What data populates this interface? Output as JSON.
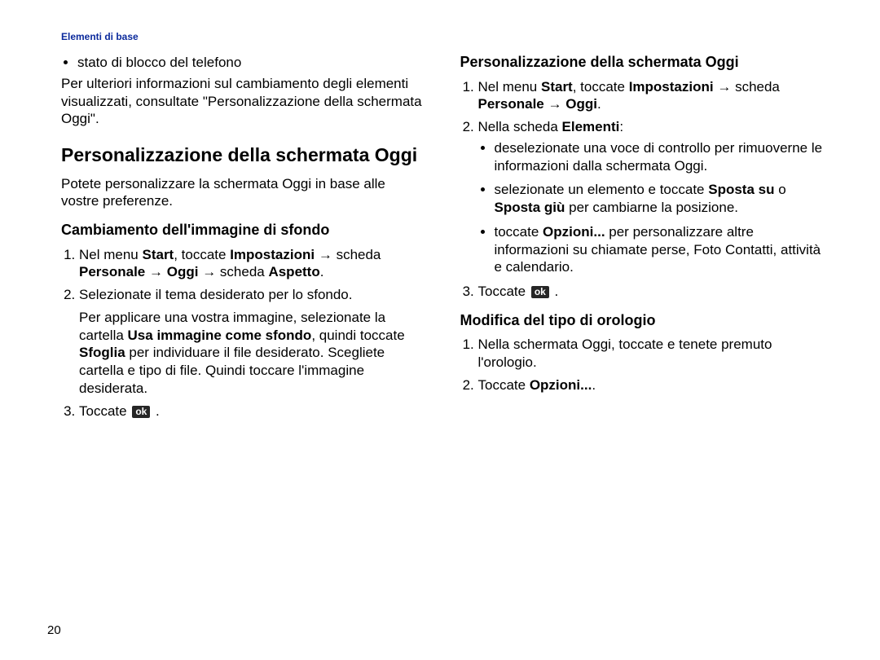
{
  "header": "Elementi di base",
  "page_number": "20",
  "arrow": "→",
  "ok_label": "ok",
  "left": {
    "bullet1": "stato di blocco del telefono",
    "intro_para": "Per ulteriori informazioni sul cambiamento degli elementi visualizzati, consultate \"Personalizzazione della schermata Oggi\".",
    "h2": "Personalizzazione della schermata Oggi",
    "h2_para": "Potete personalizzare la schermata Oggi in base alle vostre preferenze.",
    "sub1_title": "Cambiamento dell'immagine di sfondo",
    "sub1_step1_a": "Nel menu ",
    "sub1_step1_b_bold": "Start",
    "sub1_step1_c": ", toccate ",
    "sub1_step1_d_bold": "Impostazioni",
    "sub1_step1_e": " ",
    "sub1_step1_f": " scheda ",
    "sub1_step1_g_bold": "Personale",
    "sub1_step1_h": " ",
    "sub1_step1_i_bold": "Oggi",
    "sub1_step1_j": " ",
    "sub1_step1_k": " scheda ",
    "sub1_step1_l_bold": "Aspetto",
    "sub1_step1_m": ".",
    "sub1_step2": "Selezionate il tema desiderato per lo sfondo.",
    "sub1_step2_para_a": "Per applicare una vostra immagine, selezionate la cartella ",
    "sub1_step2_para_b_bold": "Usa immagine come sfondo",
    "sub1_step2_para_c": ", quindi toccate ",
    "sub1_step2_para_d_bold": "Sfoglia",
    "sub1_step2_para_e": " per individuare il file desiderato. Scegliete cartella e tipo di file. Quindi toccare l'immagine desiderata.",
    "sub1_step3_a": "Toccate ",
    "sub1_step3_c": " ."
  },
  "right": {
    "sub2_title": "Personalizzazione della schermata Oggi",
    "sub2_step1_a": "Nel menu ",
    "sub2_step1_b_bold": "Start",
    "sub2_step1_c": ", toccate ",
    "sub2_step1_d_bold": "Impostazioni",
    "sub2_step1_e": " ",
    "sub2_step1_f": " scheda ",
    "sub2_step1_g_bold": "Personale",
    "sub2_step1_h": " ",
    "sub2_step1_i_bold": "Oggi",
    "sub2_step1_j": ".",
    "sub2_step2_a": "Nella scheda ",
    "sub2_step2_b_bold": "Elementi",
    "sub2_step2_c": ":",
    "sub2_b1": "deselezionate una voce di controllo per rimuoverne le informazioni dalla schermata Oggi.",
    "sub2_b2_a": "selezionate un elemento e toccate ",
    "sub2_b2_b_bold": "Sposta su",
    "sub2_b2_c": " o ",
    "sub2_b2_d_bold": "Sposta giù",
    "sub2_b2_e": " per cambiarne la posizione.",
    "sub2_b3_a": "toccate ",
    "sub2_b3_b_bold": "Opzioni...",
    "sub2_b3_c": " per personalizzare altre informazioni su chiamate perse, Foto Contatti, attività e calendario.",
    "sub2_step3_a": "Toccate ",
    "sub2_step3_c": " .",
    "sub3_title": "Modifica del tipo di orologio",
    "sub3_step1": "Nella schermata Oggi, toccate e tenete premuto l'orologio.",
    "sub3_step2_a": "Toccate ",
    "sub3_step2_b_bold": "Opzioni...",
    "sub3_step2_c": "."
  }
}
